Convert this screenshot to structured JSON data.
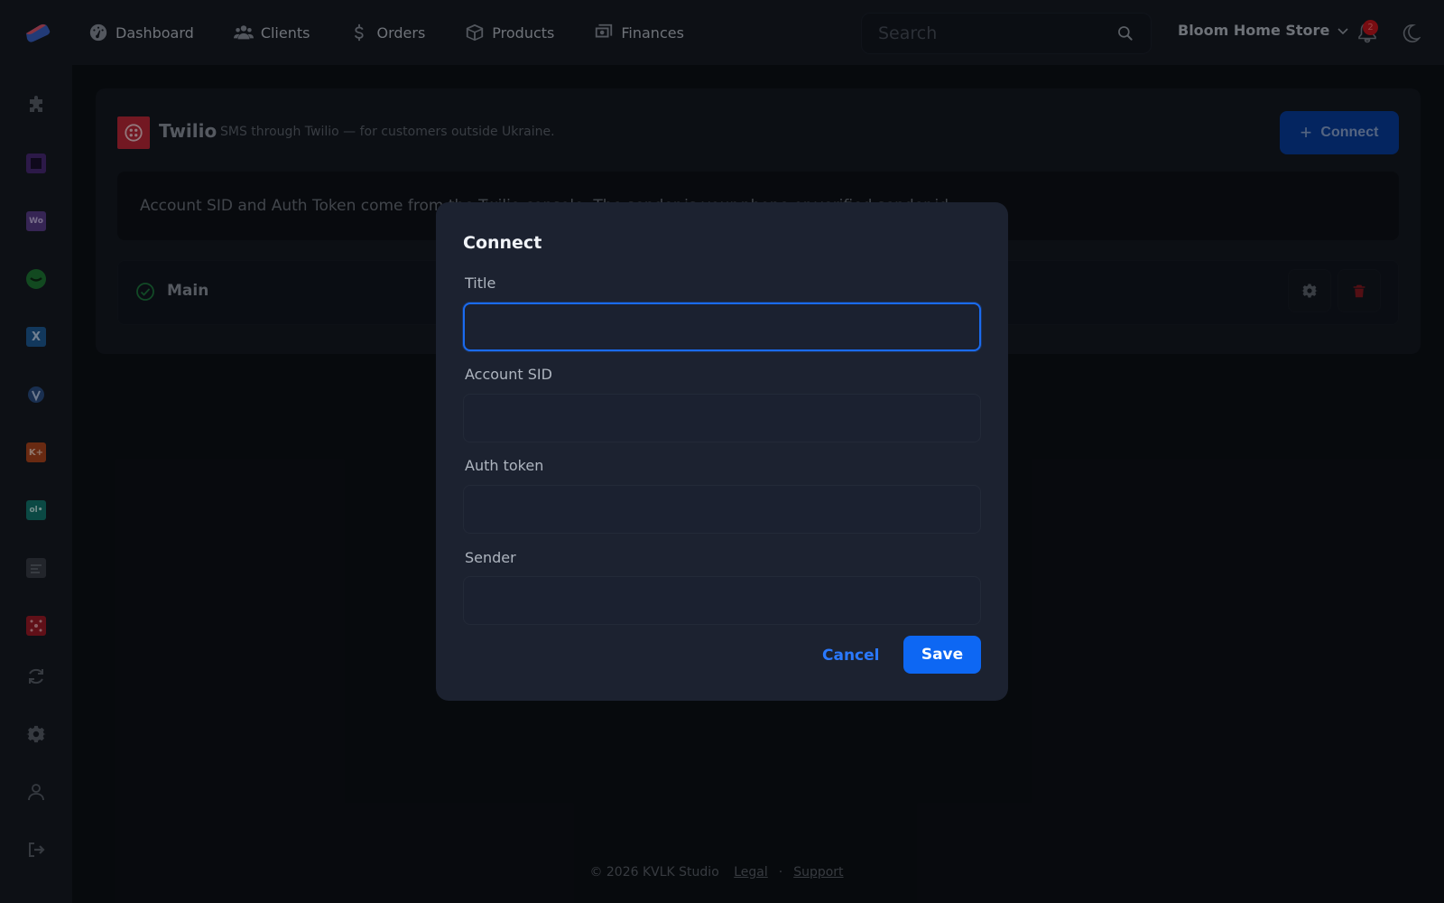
{
  "nav": {
    "items": [
      {
        "label": "Dashboard",
        "icon": "dashboard-icon"
      },
      {
        "label": "Clients",
        "icon": "users-icon"
      },
      {
        "label": "Orders",
        "icon": "dollar-icon"
      },
      {
        "label": "Products",
        "icon": "box-icon"
      },
      {
        "label": "Finances",
        "icon": "money-icon"
      }
    ],
    "search_placeholder": "Search",
    "store_name": "Bloom Home Store",
    "notification_count": "2"
  },
  "sidebar": {
    "icons": [
      "puzzle-icon",
      "square-app-icon",
      "woo-icon",
      "green-app-icon",
      "x-app-icon",
      "shield-app-icon",
      "k-plus-app-icon",
      "teal-app-icon",
      "gray-app-icon",
      "red-app-icon",
      "sync-icon",
      "gear-icon",
      "user-icon",
      "logout-icon"
    ],
    "labels": {
      "woo": "Wo",
      "x": "X",
      "kplus": "K+",
      "teal": "ol•"
    }
  },
  "integration": {
    "name": "Twilio",
    "description": "SMS through Twilio — for customers outside Ukraine.",
    "connect_label": "Connect",
    "info": "Account SID and Auth Token come from the Twilio console. The sender is your phone or verified sender id.",
    "accounts": [
      {
        "name": "Main",
        "status": "active"
      }
    ]
  },
  "modal": {
    "title": "Connect",
    "fields": [
      {
        "label": "Title",
        "value": ""
      },
      {
        "label": "Account SID",
        "value": ""
      },
      {
        "label": "Auth token",
        "value": ""
      },
      {
        "label": "Sender",
        "value": ""
      }
    ],
    "cancel_label": "Cancel",
    "save_label": "Save"
  },
  "footer": {
    "copyright": "© 2026 KVLK Studio",
    "legal": "Legal",
    "separator": "·",
    "support": "Support"
  },
  "colors": {
    "accent": "#0d67f3",
    "background": "#0d1117",
    "modal": "#1c2230",
    "twilio": "#c0283a",
    "danger": "#c9161e"
  }
}
